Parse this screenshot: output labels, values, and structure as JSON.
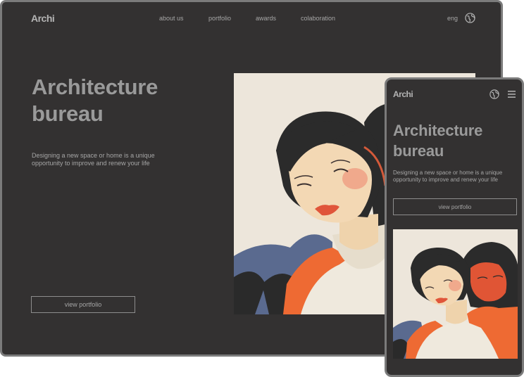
{
  "desktop": {
    "logo": "Archi",
    "nav": [
      "about us",
      "portfolio",
      "awards",
      "colaboration"
    ],
    "language": "eng",
    "hero_title_line1": "Architecture",
    "hero_title_line2": "bureau",
    "hero_subtitle": "Designing a new space or home is a unique opportunity to improve and renew your life",
    "cta_label": "view portfolio"
  },
  "mobile": {
    "logo": "Archi",
    "hero_title_line1": "Architecture",
    "hero_title_line2": "bureau",
    "hero_subtitle": "Designing a new space or home is a unique opportunity to improve and renew your life",
    "cta_label": "view portfolio"
  },
  "icons": {
    "globe": "globe-icon",
    "menu": "hamburger-menu-icon"
  },
  "colors": {
    "background": "#333131",
    "frame": "#7b7b7b",
    "art_background": "#ede6db",
    "accent_orange": "#ee6a33",
    "accent_blue": "#5a6a8f"
  }
}
